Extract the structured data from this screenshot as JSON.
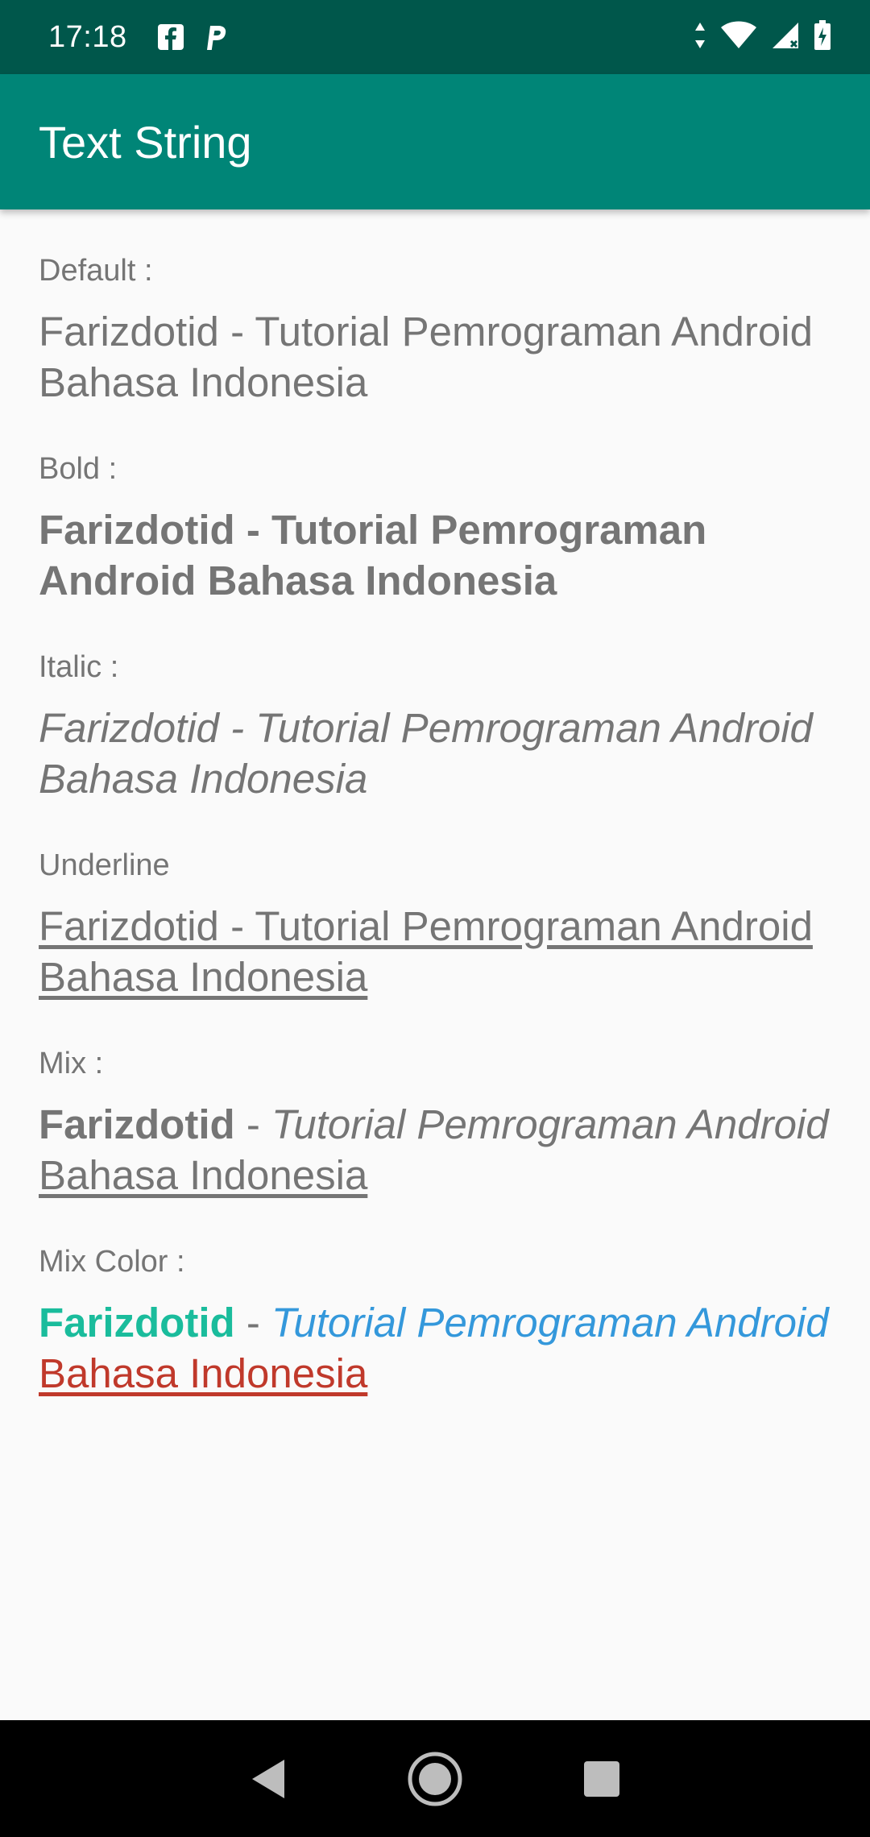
{
  "status_bar": {
    "time": "17:18",
    "left_icons": [
      "facebook-notification-icon",
      "parking-notification-icon"
    ],
    "right_icons": [
      "data-arrows-icon",
      "wifi-icon",
      "signal-icon",
      "battery-charging-icon"
    ]
  },
  "app_bar": {
    "title": "Text String"
  },
  "sections": {
    "default": {
      "label": "Default :",
      "text": "Farizdotid - Tutorial Pemrograman Android Bahasa Indonesia"
    },
    "bold": {
      "label": "Bold :",
      "text": "Farizdotid - Tutorial Pemrograman Android Bahasa Indonesia"
    },
    "italic": {
      "label": "Italic :",
      "text": "Farizdotid - Tutorial Pemrograman Android Bahasa Indonesia"
    },
    "underline": {
      "label": "Underline",
      "text": "Farizdotid - Tutorial Pemrograman Android Bahasa Indonesia"
    },
    "mix": {
      "label": "Mix :",
      "part_bold": "Farizdotid",
      "separator": " - ",
      "part_italic": "Tutorial Pemrograman Android",
      "part_underline": "Bahasa Indonesia"
    },
    "mix_color": {
      "label": "Mix Color :",
      "part_bold": "Farizdotid",
      "separator": " - ",
      "part_italic": "Tutorial Pemrograman Android",
      "part_underline": "Bahasa Indonesia"
    }
  },
  "colors": {
    "status_bar": "#00574b",
    "app_bar": "#008577",
    "text_gray": "#757575",
    "mix_green": "#1abc9c",
    "mix_blue": "#3498db",
    "mix_red": "#c0392b"
  },
  "nav_bar": {
    "icons": [
      "back-icon",
      "home-icon",
      "recents-icon"
    ]
  }
}
